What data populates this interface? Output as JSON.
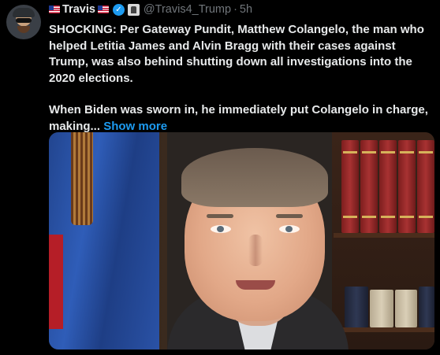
{
  "tweet": {
    "display_name": "Travis",
    "handle": "@Travis4_Trump",
    "separator": "·",
    "time": "5h",
    "paragraph1": "SHOCKING:  Per Gateway Pundit, Matthew Colangelo, the man who helped Letitia James and Alvin Bragg with their cases against Trump, was also behind shutting down all investigations into the 2020 elections.",
    "paragraph2": "When Biden was sworn in, he immediately put Colangelo in charge, making...",
    "show_more_label": "Show more"
  },
  "icons": {
    "flag": "us-flag-icon",
    "verified": "verified-badge-icon",
    "affiliation": "affiliation-badge-icon"
  },
  "colors": {
    "background": "#000000",
    "text": "#e7e9ea",
    "muted": "#71767b",
    "link": "#1d9bf0"
  }
}
